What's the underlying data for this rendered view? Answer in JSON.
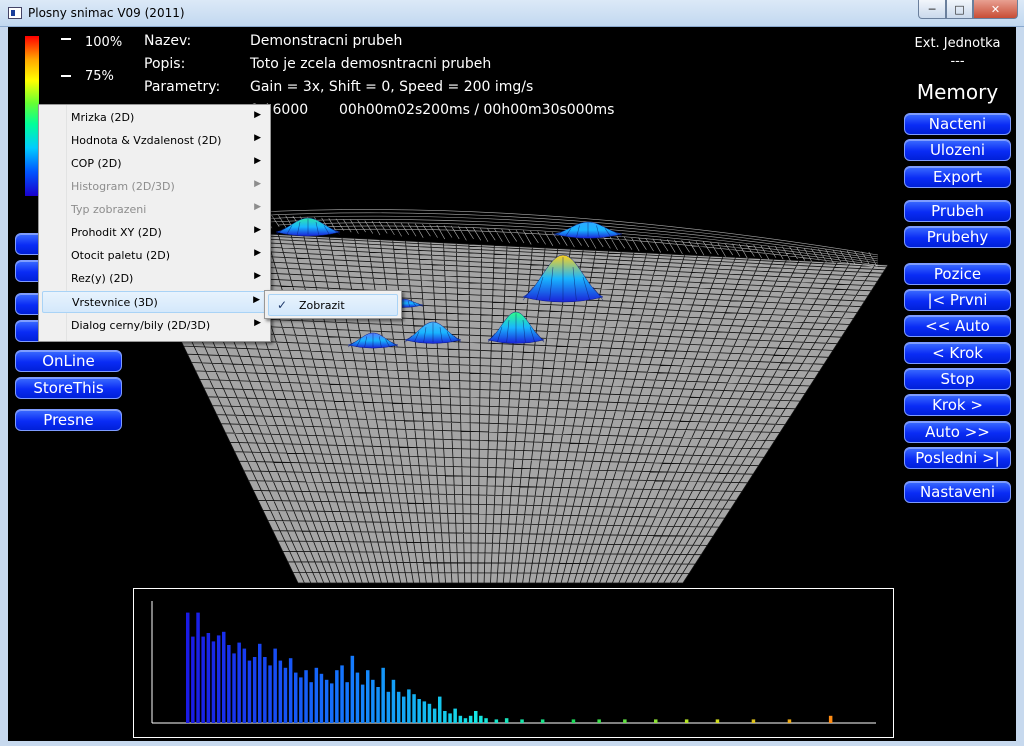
{
  "window": {
    "title": "Plosny snimac V09 (2011)",
    "minimize_glyph": "─",
    "maximize_glyph": "□",
    "close_glyph": "✕"
  },
  "scale": {
    "top_label": "100%",
    "second_label": "75%"
  },
  "info": {
    "name_label": "Nazev:",
    "name_value": "Demonstracni prubeh",
    "desc_label": "Popis:",
    "desc_value": "Toto je zcela demosntracni prubeh",
    "params_label": "Parametry:",
    "params_value": "Gain = 3x, Shift = 0, Speed = 200 img/s",
    "frame_value": "0 / 6000",
    "time_value": "00h00m02s200ms / 00h00m30s000ms"
  },
  "ext_unit": {
    "label": "Ext. Jednotka",
    "value": "---"
  },
  "memory": {
    "heading": "Memory",
    "load": "Nacteni",
    "save": "Ulozeni",
    "export": "Export"
  },
  "playback": {
    "prubeh": "Prubeh",
    "prubehy": "Prubehy",
    "position": "Pozice",
    "first": "|< Prvni",
    "auto_back": "<< Auto",
    "step_back": "< Krok",
    "stop": "Stop",
    "step_forward": "Krok >",
    "auto_forward": "Auto >>",
    "last": "Posledni >|",
    "settings": "Nastaveni"
  },
  "left_buttons": {
    "online": "OnLine",
    "store_this": "StoreThis",
    "precise": "Presne"
  },
  "context_menu": {
    "items": [
      {
        "label": "Mrizka (2D)",
        "enabled": true
      },
      {
        "label": "Hodnota & Vzdalenost (2D)",
        "enabled": true
      },
      {
        "label": "COP (2D)",
        "enabled": true
      },
      {
        "label": "Histogram (2D/3D)",
        "enabled": false
      },
      {
        "label": "Typ zobrazeni",
        "enabled": false
      },
      {
        "label": "Prohodit XY (2D)",
        "enabled": true
      },
      {
        "label": "Otocit paletu (2D)",
        "enabled": true
      },
      {
        "label": "Rez(y) (2D)",
        "enabled": true
      },
      {
        "label": "Vrstevnice (3D)",
        "enabled": true,
        "highlighted": true
      },
      {
        "label": "Dialog cerny/bily (2D/3D)",
        "enabled": true
      }
    ],
    "arrow_glyph": "▶",
    "submenu": {
      "label": "Zobrazit",
      "checked": true,
      "check_glyph": "✓"
    }
  },
  "histogram": {
    "bars": [
      0.92,
      0.72,
      0.92,
      0.72,
      0.75,
      0.68,
      0.73,
      0.76,
      0.65,
      0.58,
      0.67,
      0.62,
      0.52,
      0.55,
      0.66,
      0.55,
      0.48,
      0.62,
      0.52,
      0.46,
      0.54,
      0.42,
      0.38,
      0.44,
      0.34,
      0.46,
      0.41,
      0.36,
      0.33,
      0.44,
      0.48,
      0.34,
      0.56,
      0.42,
      0.32,
      0.44,
      0.36,
      0.3,
      0.46,
      0.26,
      0.36,
      0.26,
      0.22,
      0.28,
      0.24,
      0.2,
      0.18,
      0.16,
      0.12,
      0.22,
      0.1,
      0.08,
      0.12,
      0.06,
      0.04,
      0.06,
      0.1,
      0.06,
      0.04,
      0.0,
      0.03,
      0.0,
      0.04,
      0.0,
      0.0,
      0.03,
      0.0,
      0.0,
      0.0,
      0.03,
      0.0,
      0.0,
      0.0,
      0.0,
      0.0,
      0.03,
      0.0,
      0.0,
      0.0,
      0.0,
      0.03,
      0.0,
      0.0,
      0.0,
      0.0,
      0.03,
      0.0,
      0.0,
      0.0,
      0.0,
      0.0,
      0.03,
      0.0,
      0.0,
      0.0,
      0.0,
      0.0,
      0.03,
      0.0,
      0.0,
      0.0,
      0.0,
      0.0,
      0.03,
      0.0,
      0.0,
      0.0,
      0.0,
      0.0,
      0.0,
      0.03,
      0.0,
      0.0,
      0.0,
      0.0,
      0.0,
      0.0,
      0.03,
      0.0,
      0.0,
      0.0,
      0.0,
      0.0,
      0.0,
      0.0,
      0.06
    ]
  },
  "colors": {
    "button_blue": "#0a2cf5",
    "grid_gray": "#a5a5a5",
    "plot_bg": "#000000"
  }
}
